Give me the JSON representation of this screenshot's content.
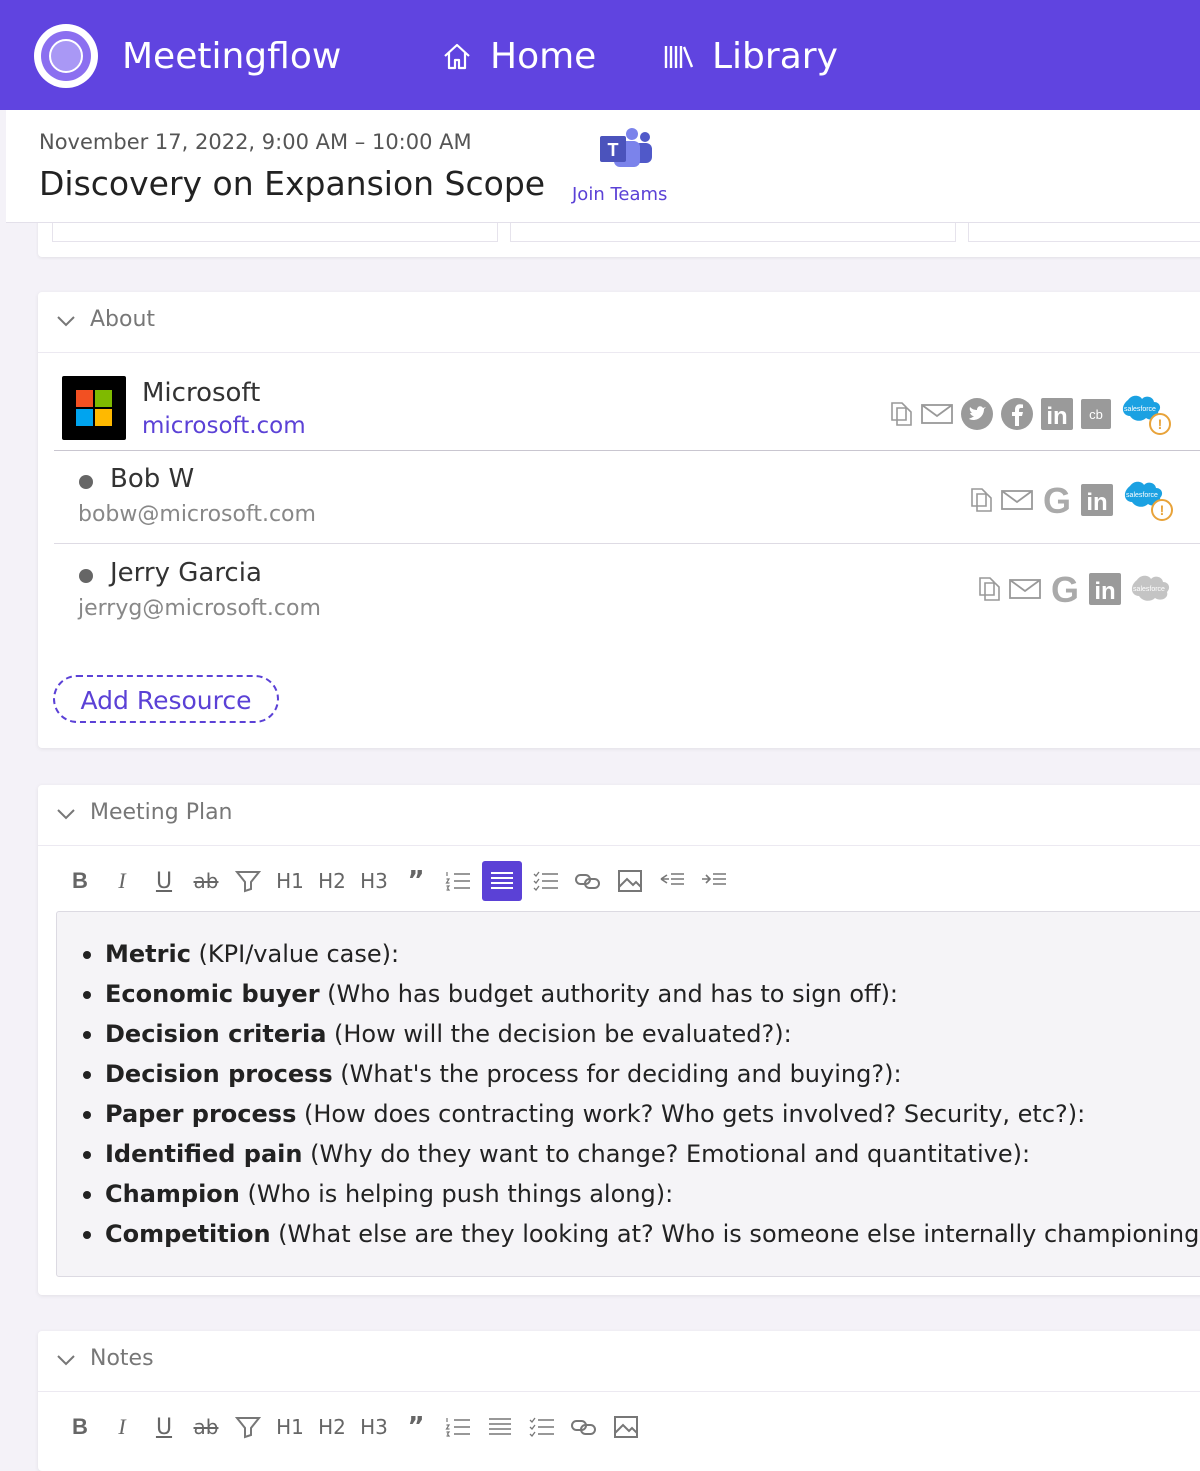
{
  "nav": {
    "app_name": "Meetingflow",
    "home_label": "Home",
    "library_label": "Library"
  },
  "meeting": {
    "time": "November 17, 2022, 9:00 AM – 10:00 AM",
    "title": "Discovery on Expansion Scope",
    "join_label": "Join Teams"
  },
  "about": {
    "title": "About",
    "company": {
      "name": "Microsoft",
      "domain": "microsoft.com"
    },
    "people": [
      {
        "name": "Bob W",
        "email": "bobw@microsoft.com"
      },
      {
        "name": "Jerry Garcia",
        "email": "jerryg@microsoft.com"
      }
    ],
    "add_resource_label": "Add Resource"
  },
  "plan": {
    "title": "Meeting Plan",
    "items": [
      {
        "term": "Metric",
        "desc": " (KPI/value case):"
      },
      {
        "term": "Economic buyer",
        "desc": " (Who has budget authority and has to sign off):"
      },
      {
        "term": "Decision criteria",
        "desc": " (How will the decision be evaluated?):"
      },
      {
        "term": "Decision process",
        "desc": " (What's the process for deciding and buying?):"
      },
      {
        "term": "Paper process",
        "desc": " (How does contracting work? Who gets involved? Security, etc?):"
      },
      {
        "term": "Identified pain",
        "desc": " (Why do they want to change? Emotional and quantitative):"
      },
      {
        "term": "Champion",
        "desc": " (Who is helping push things along):"
      },
      {
        "term": "Competition",
        "desc": " (What else are they looking at? Who is someone else internally championing)?"
      }
    ]
  },
  "notes": {
    "title": "Notes"
  },
  "toolbar": {
    "b": "B",
    "i": "I",
    "u": "U",
    "s": "ab",
    "h1": "H1",
    "h2": "H2",
    "h3": "H3",
    "quote": "”"
  },
  "icons": {
    "salesforce_text": "salesforce",
    "crunchbase_text": "cb",
    "linkedin_text": "in",
    "google_text": "G",
    "warning_text": "!"
  },
  "colors": {
    "accent": "#5b41d6",
    "topbar": "#6044e0",
    "warning": "#e8a33a",
    "salesforce": "#1ba1e2"
  }
}
